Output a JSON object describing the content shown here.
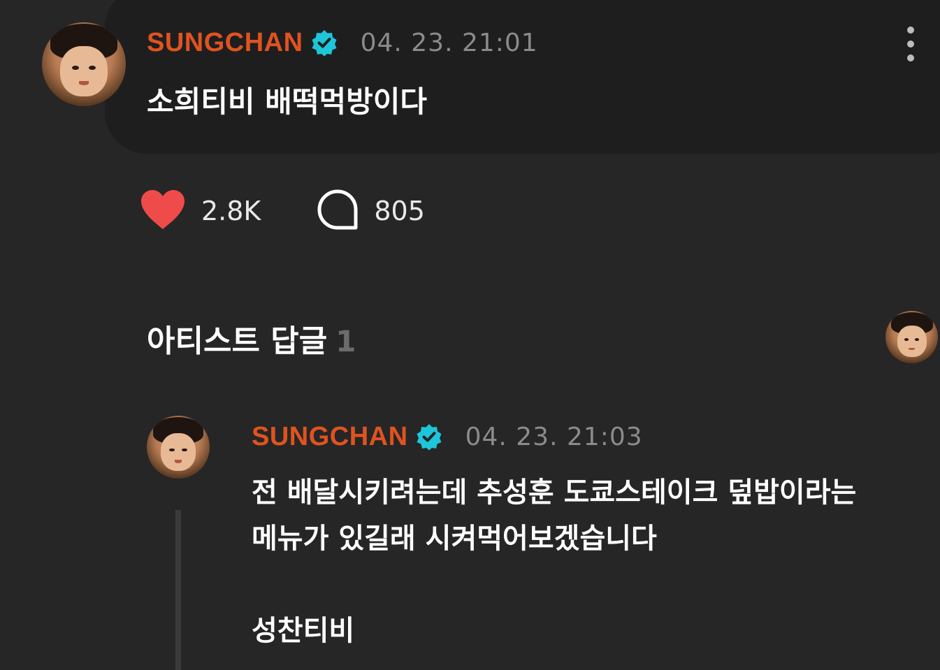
{
  "post": {
    "author": "SUNGCHAN",
    "timestamp": "04. 23. 21:01",
    "text": "소희티비 배떡먹방이다",
    "likes": "2.8K",
    "comments": "805"
  },
  "artist_replies": {
    "label": "아티스트 답글",
    "count": "1"
  },
  "reply": {
    "author": "SUNGCHAN",
    "timestamp": "04. 23. 21:03",
    "lines": [
      "전 배달시키려는데 추성훈 도쿄스테이크 덮밥이라는",
      "메뉴가 있길래 시켜먹어보겠습니다",
      "성찬티비"
    ]
  },
  "colors": {
    "background": "#262627",
    "card": "#1e1e1f",
    "author": "#e0531f",
    "verified": "#1ec6d9",
    "heart": "#f04b4b",
    "muted": "#8b8b8b"
  },
  "icons": [
    "verified-badge-icon",
    "more-vertical-icon",
    "heart-icon",
    "comment-bubble-icon"
  ]
}
